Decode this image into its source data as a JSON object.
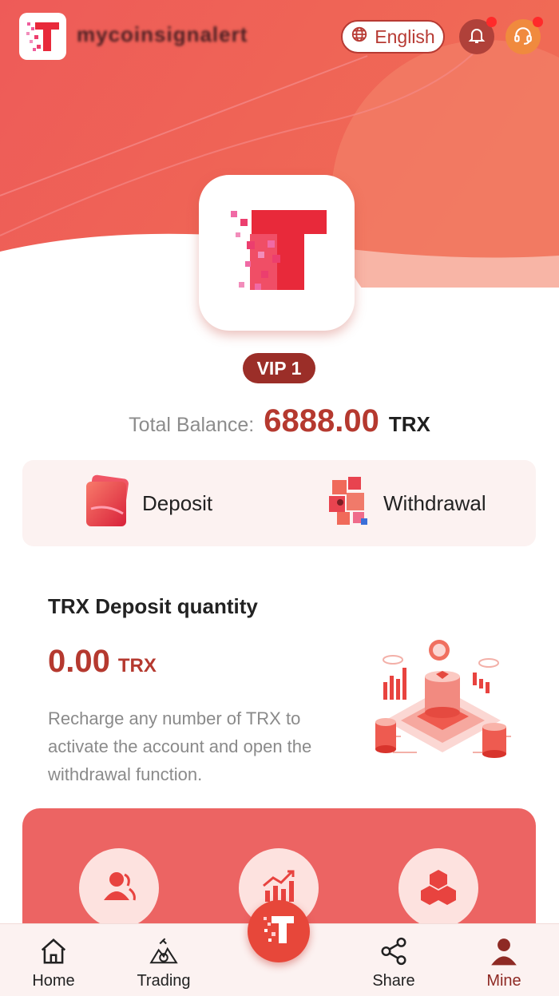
{
  "header": {
    "site_name": "mycoinsignalert",
    "language_label": "English",
    "bell_icon": "bell-icon",
    "support_icon": "headset-icon"
  },
  "profile": {
    "vip_label": "VIP 1",
    "balance_label": "Total Balance:",
    "balance_value": "6888.00",
    "balance_unit": "TRX"
  },
  "actions": {
    "deposit_label": "Deposit",
    "withdrawal_label": "Withdrawal"
  },
  "deposit_quantity": {
    "title": "TRX Deposit quantity",
    "value": "0.00",
    "unit": "TRX",
    "description": "Recharge any number of TRX to activate the account and open the withdrawal function."
  },
  "features": [
    {
      "icon": "team-icon"
    },
    {
      "icon": "growth-chart-icon"
    },
    {
      "icon": "cubes-icon"
    }
  ],
  "nav": {
    "items": [
      {
        "label": "Home",
        "icon": "home-icon"
      },
      {
        "label": "Trading",
        "icon": "trading-icon"
      },
      {
        "label": "Share",
        "icon": "share-icon"
      },
      {
        "label": "Mine",
        "icon": "user-icon"
      }
    ],
    "active": "Mine"
  },
  "colors": {
    "brand_red": "#e7473a",
    "dark_red": "#9b2e28",
    "accent_red": "#b5392f",
    "panel_red": "#ec6463",
    "card_bg": "#fcf2f1"
  }
}
